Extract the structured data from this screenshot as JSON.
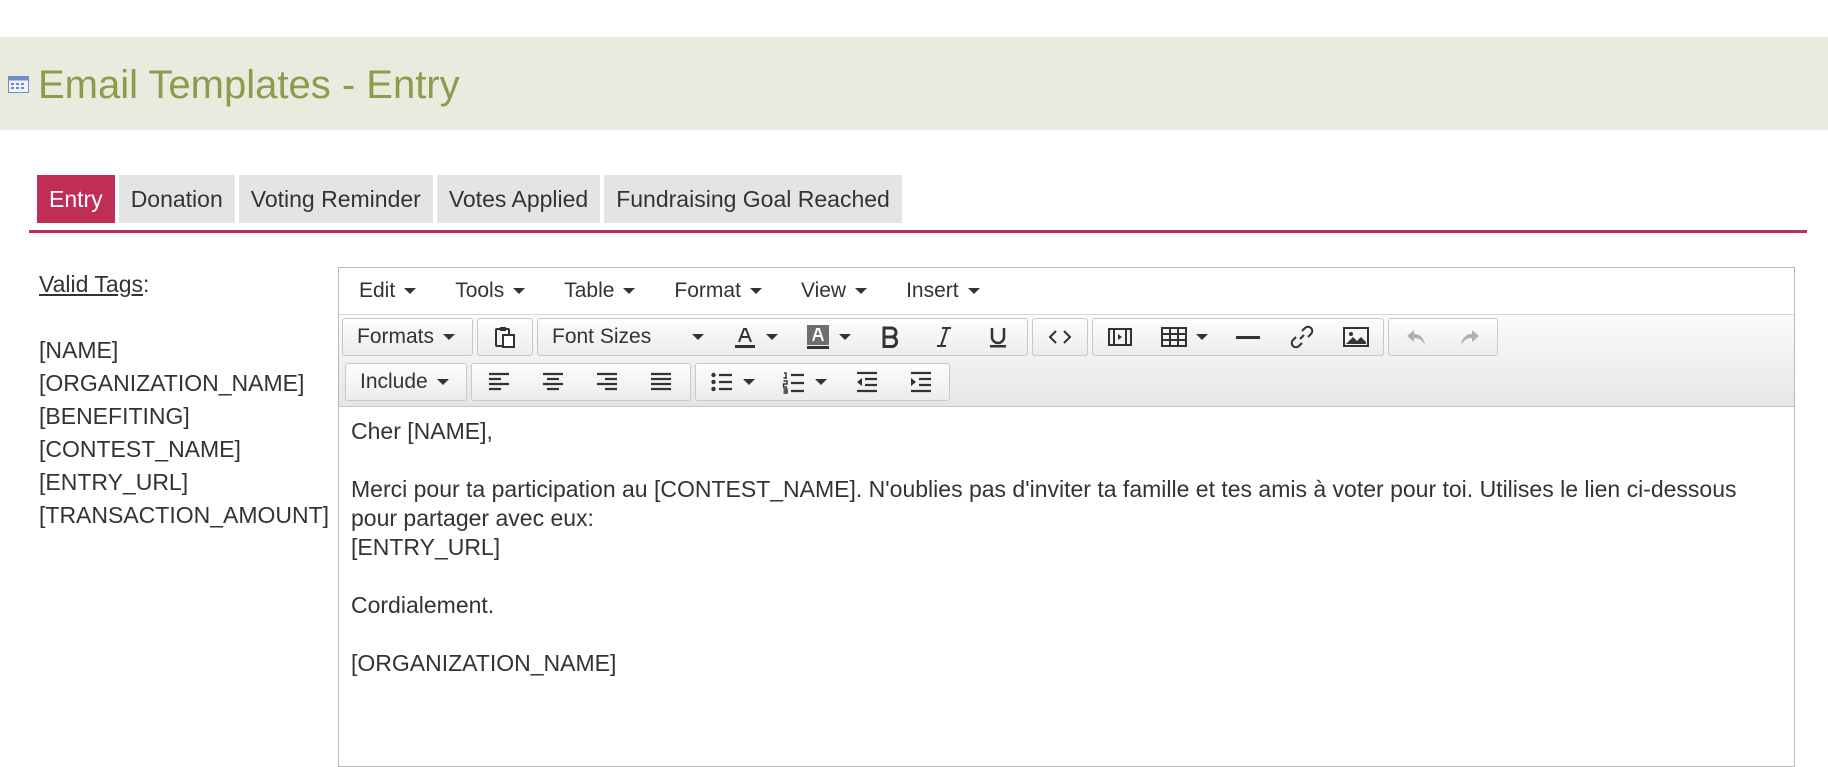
{
  "header": {
    "title": "Email Templates - Entry",
    "icon": "calendar-icon",
    "background": "#e8ebdd",
    "title_color": "#8d9b4a"
  },
  "tabs": [
    {
      "label": "Entry",
      "active": true
    },
    {
      "label": "Donation",
      "active": false
    },
    {
      "label": "Voting Reminder",
      "active": false
    },
    {
      "label": "Votes Applied",
      "active": false
    },
    {
      "label": "Fundraising Goal Reached",
      "active": false
    }
  ],
  "accent_color": "#c02d55",
  "valid_tags": {
    "title": "Valid Tags",
    "suffix": ":",
    "items": [
      "[NAME]",
      "[ORGANIZATION_NAME]",
      "[BENEFITING]",
      "[CONTEST_NAME]",
      "[ENTRY_URL]",
      "[TRANSACTION_AMOUNT]"
    ]
  },
  "editor": {
    "menu": [
      "Edit",
      "Tools",
      "Table",
      "Format",
      "View",
      "Insert"
    ],
    "toolbar": {
      "formats_label": "Formats",
      "font_sizes_label": "Font Sizes",
      "include_label": "Include",
      "icons": [
        "paste-icon",
        "text-color-icon",
        "background-color-icon",
        "bold-icon",
        "italic-icon",
        "underline-icon",
        "source-code-icon",
        "media-icon",
        "table-icon",
        "horizontal-rule-icon",
        "link-icon",
        "image-icon",
        "undo-icon",
        "redo-icon",
        "align-left-icon",
        "align-center-icon",
        "align-right-icon",
        "justify-icon",
        "bullet-list-icon",
        "numbered-list-icon",
        "outdent-icon",
        "indent-icon"
      ]
    },
    "content": {
      "greeting": "Cher [NAME],",
      "body": "Merci pour ta participation au [CONTEST_NAME]. N'oublies pas d'inviter ta famille et tes amis à voter pour toi. Utilises le lien ci-dessous pour partager avec eux:",
      "url": "[ENTRY_URL]",
      "closing": "Cordialement.",
      "signature": "[ORGANIZATION_NAME]"
    }
  }
}
